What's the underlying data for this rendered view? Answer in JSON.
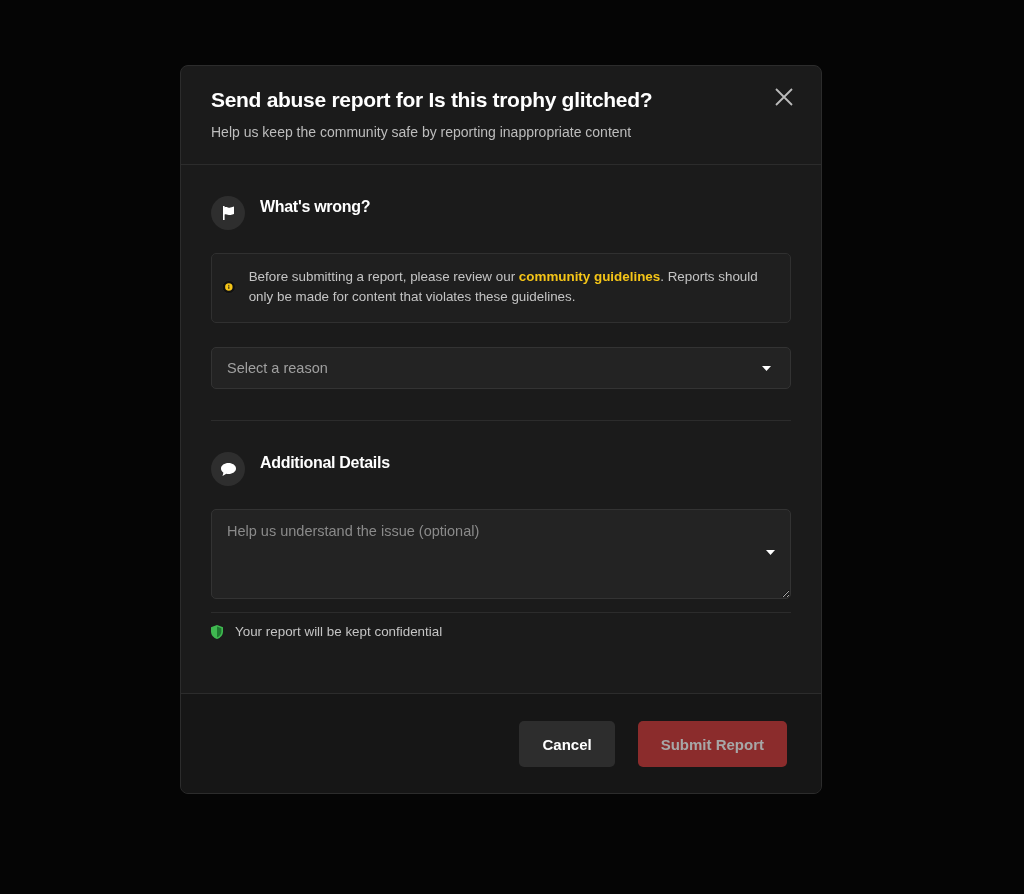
{
  "dialog": {
    "title": "Send abuse report for Is this trophy glitched?",
    "subtitle": "Help us keep the community safe by reporting inappropriate content"
  },
  "sections": [
    {
      "kind": "reason",
      "heading": "What's wrong?",
      "notice": {
        "before": "Before submitting a report, please review our ",
        "link": "community guidelines",
        "after": ". Reports should only be made for content that violates these guidelines."
      },
      "field": {
        "placeholder": "Select a reason"
      }
    },
    {
      "kind": "details",
      "heading": "Additional Details",
      "field": {
        "placeholder": "Help us understand the issue (optional)"
      },
      "note": "Your report will be kept confidential"
    }
  ],
  "buttons": [
    {
      "label": "Cancel",
      "kind": "secondary",
      "disabled": false
    },
    {
      "label": "Submit Report",
      "kind": "primary",
      "disabled": true
    }
  ]
}
